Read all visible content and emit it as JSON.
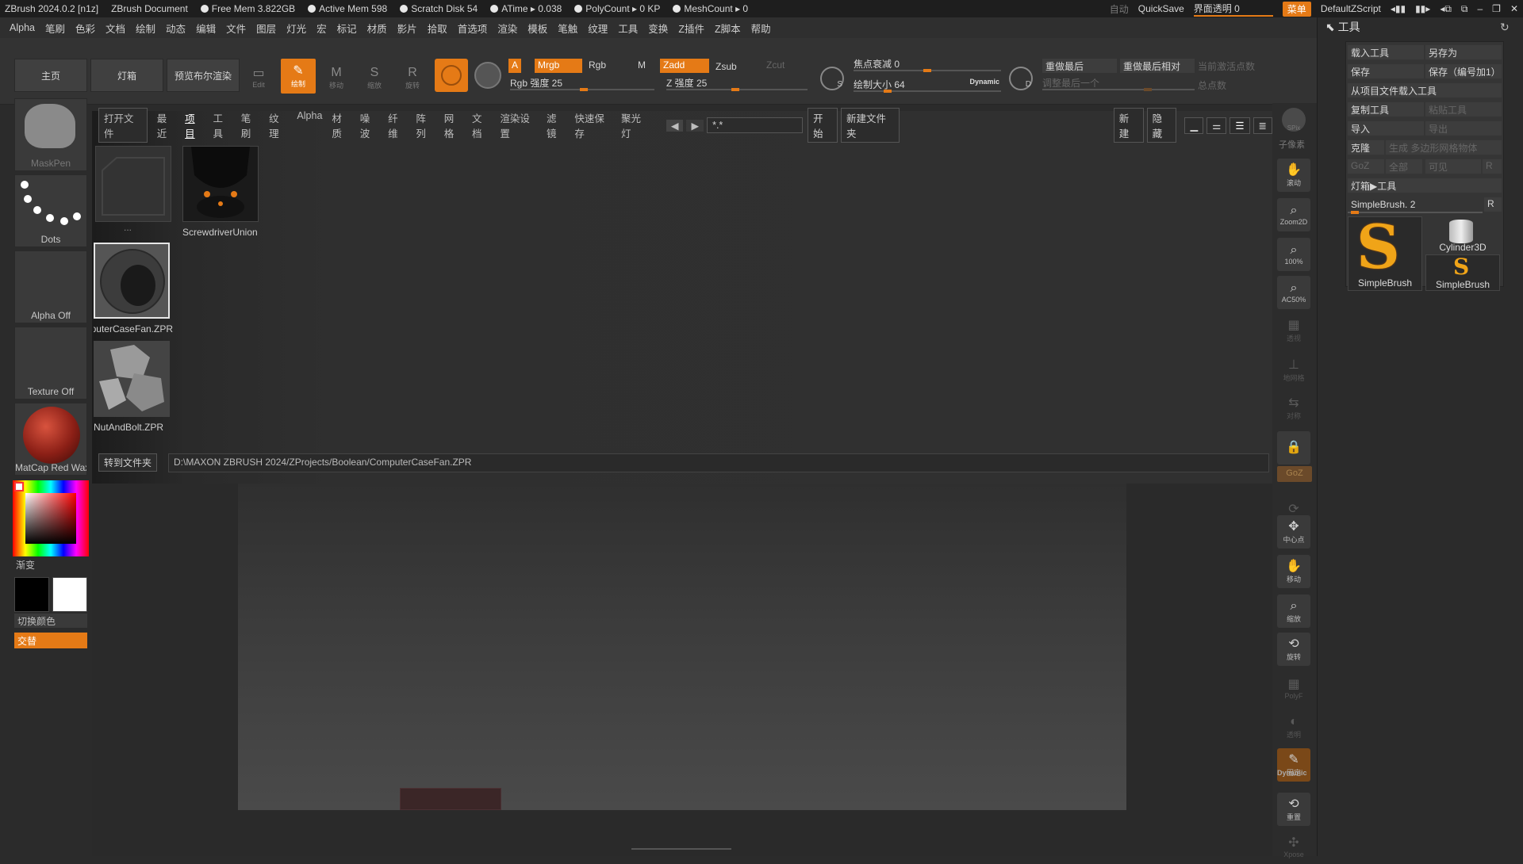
{
  "titlebar": {
    "app": "ZBrush 2024.0.2 [n1z]",
    "doc": "ZBrush Document",
    "free_mem": "Free Mem 3.822GB",
    "active_mem": "Active Mem 598",
    "scratch": "Scratch Disk 54",
    "atime": "ATime ▸ 0.038",
    "polycount": "PolyCount ▸ 0 KP",
    "meshcount": "MeshCount ▸ 0",
    "auto": "自动",
    "quicksave": "QuickSave",
    "ui_transparency": "界面透明 0",
    "menu": "菜单",
    "default_script": "DefaultZScript"
  },
  "menubar": [
    "Alpha",
    "笔刷",
    "色彩",
    "文档",
    "绘制",
    "动态",
    "编辑",
    "文件",
    "图层",
    "灯光",
    "宏",
    "标记",
    "材质",
    "影片",
    "拾取",
    "首选项",
    "渲染",
    "模板",
    "笔触",
    "纹理",
    "工具",
    "变换",
    "Z插件",
    "Z脚本",
    "帮助"
  ],
  "shelf": {
    "home": "主页",
    "lightbox": "灯箱",
    "preview_bool": "预览布尔渲染",
    "tools": [
      {
        "label": "Edit",
        "icon": "edit-icon"
      },
      {
        "label": "绘制",
        "icon": "draw-icon"
      },
      {
        "label": "移动",
        "icon": "move-icon"
      },
      {
        "label": "缩放",
        "icon": "scale-icon"
      },
      {
        "label": "旋转",
        "icon": "rotate-icon"
      }
    ],
    "a": "A",
    "mrgb": "Mrgb",
    "rgb": "Rgb",
    "m": "M",
    "rgb_intensity": "Rgb 强度 25",
    "zadd": "Zadd",
    "zsub": "Zsub",
    "zcut": "Zcut",
    "z_intensity": "Z 强度 25",
    "focal_shift": "焦点衰减 0",
    "draw_size": "绘制大小 64",
    "dynamic": "Dynamic",
    "redo_last": "重做最后",
    "redo_last_rel": "重做最后相对",
    "adjust_last": "调整最后一个",
    "active_points": "当前激活点数",
    "total_points": "总点数",
    "s_label": "S",
    "d_label": "D"
  },
  "left": {
    "brush": "MaskPen",
    "stroke": "Dots",
    "alpha": "Alpha Off",
    "texture": "Texture Off",
    "material": "MatCap Red Wax",
    "gradient": "渐变",
    "switch_color": "切换颜色",
    "alternate": "交替",
    "colors": {
      "material": "#8b1f16",
      "primary": "#000000",
      "secondary": "#ffffff",
      "accent": "#e57a16"
    }
  },
  "browser": {
    "open_file": "打开文件",
    "tabs": [
      "最近",
      "项目",
      "工具",
      "笔刷",
      "纹理",
      "Alpha",
      "材质",
      "噪波",
      "纤维",
      "阵列",
      "网格",
      "文档",
      "渲染设置",
      "滤镜",
      "快速保存",
      "聚光灯"
    ],
    "search_value": "*.*",
    "start": "开始",
    "new_folder": "新建文件夹",
    "new": "新建",
    "hide": "隐藏",
    "files": [
      "...",
      "ScrewdriverUnion",
      "ComputerCaseFan.ZPR",
      "NutAndBolt.ZPR"
    ],
    "goto_folder": "转到文件夹",
    "path": "D:\\MAXON ZBRUSH 2024/ZProjects/Boolean/ComputerCaseFan.ZPR"
  },
  "rightcol": {
    "spix": "SPix",
    "subpixel": "子像素",
    "items": [
      "滚动",
      "Zoom2D",
      "100%",
      "AC50%",
      "透视",
      "地网格",
      "对称",
      "",
      "GoZ",
      "",
      "中心点",
      "移动",
      "缩放",
      "旋转",
      "PolyF",
      "透明",
      "固定",
      "Dynamic",
      "重置",
      "Xpose"
    ]
  },
  "toolpanel": {
    "title": "工具",
    "load_tool": "载入工具",
    "save_as": "另存为",
    "save": "保存",
    "save_inc": "保存（编号加1）",
    "load_from_project": "从项目文件载入工具",
    "copy_tool": "复制工具",
    "paste_tool": "粘贴工具",
    "import": "导入",
    "export": "导出",
    "clone": "克隆",
    "make_polymesh": "生成 多边形网格物体",
    "goz": "GoZ",
    "all": "全部",
    "visible": "可见",
    "r": "R",
    "lightbox_tools": "灯箱▶工具",
    "current_tool": "SimpleBrush. 2",
    "thumbs": [
      "SimpleBrush",
      "Cylinder3D",
      "SimpleBrush"
    ]
  }
}
